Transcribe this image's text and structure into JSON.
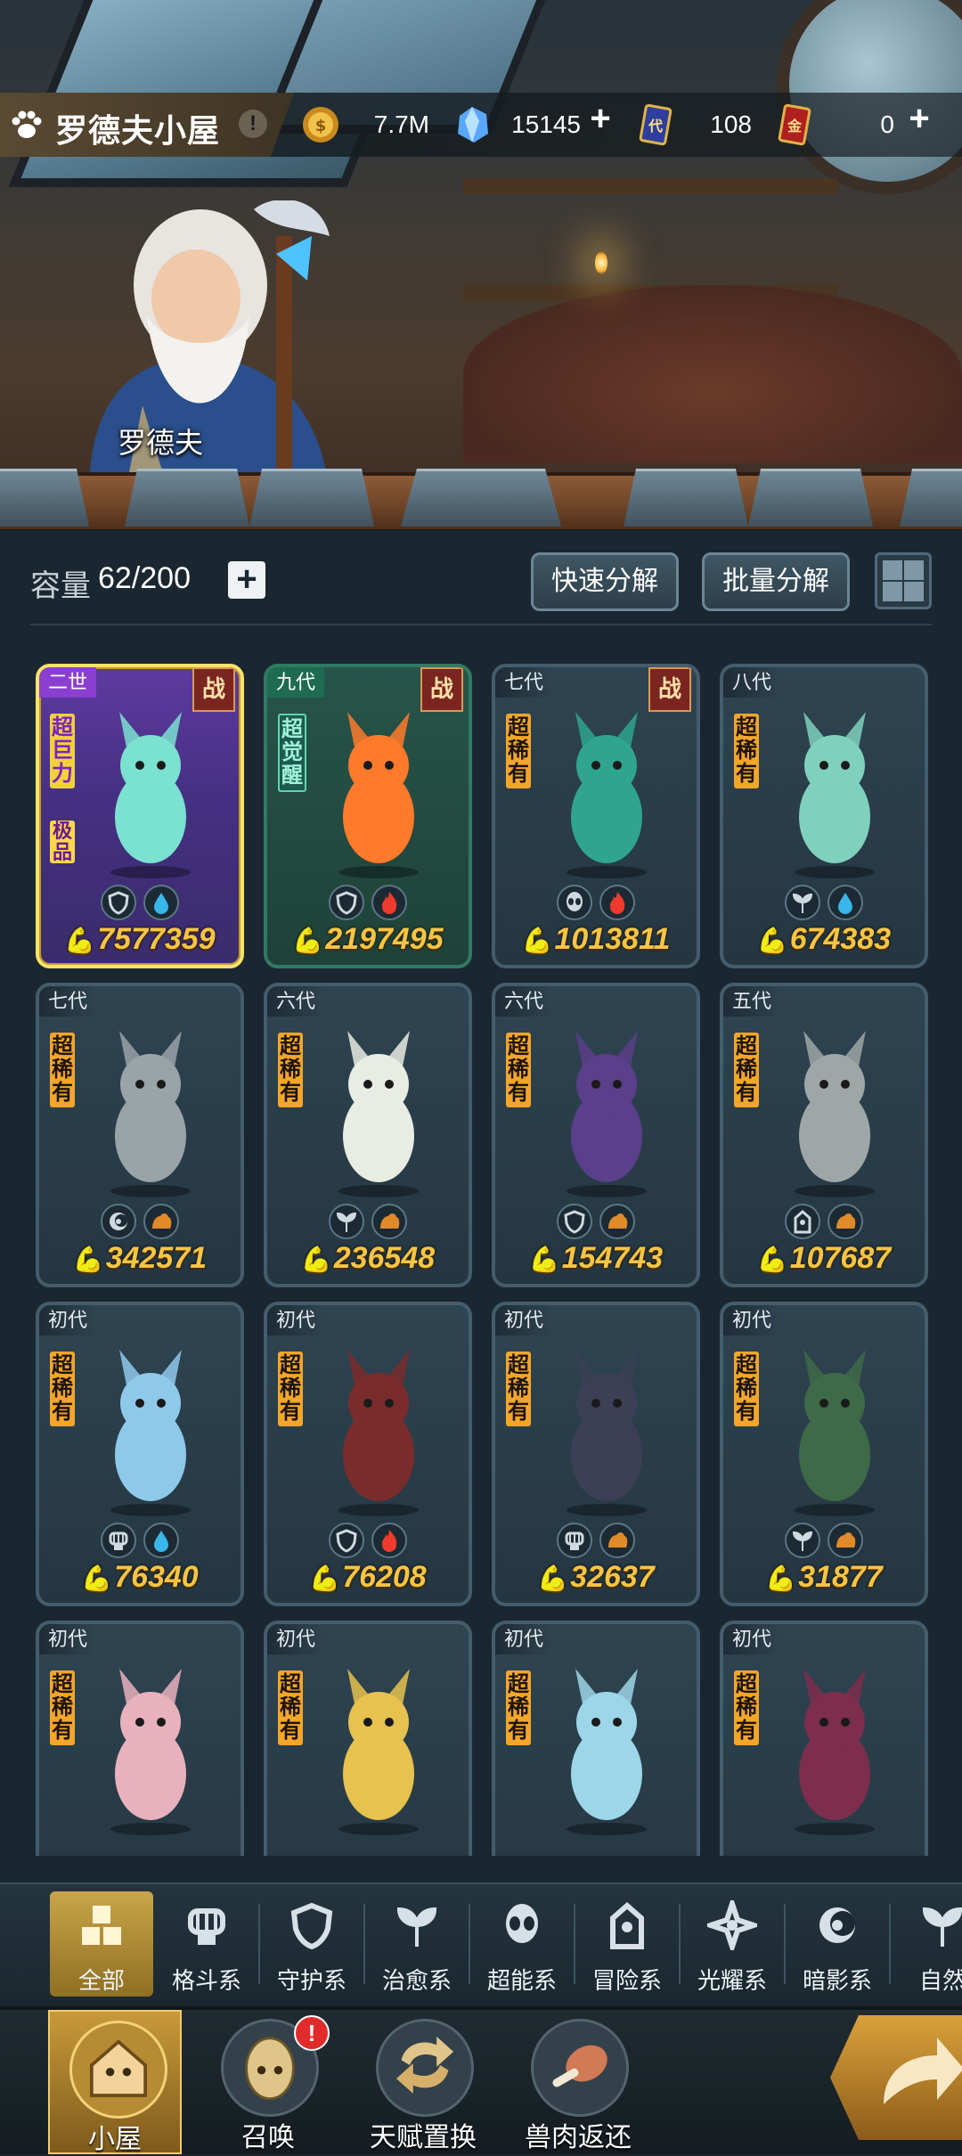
{
  "header": {
    "title": "罗德夫小屋",
    "info_icon": "!",
    "npc_name": "罗德夫"
  },
  "resources": [
    {
      "icon": "gold-coin-icon",
      "value": "7.7M",
      "has_plus": false
    },
    {
      "icon": "crystal-icon",
      "value": "15145",
      "has_plus": true
    },
    {
      "icon": "card-ticket-icon",
      "value": "108",
      "has_plus": false
    },
    {
      "icon": "gold-ticket-icon",
      "value": "0",
      "has_plus": true
    }
  ],
  "toolbar": {
    "capacity_label": "容量",
    "capacity_value": "62/200",
    "plus": "+",
    "quick_decompose": "快速分解",
    "batch_decompose": "批量分解"
  },
  "cards": [
    {
      "gen": "二世",
      "rarity": "超巨力",
      "quality": "极品",
      "war": "战",
      "style": "gold",
      "elements": [
        "guard-icon",
        "water-icon"
      ],
      "power": "7577359",
      "color": "#7be1d0"
    },
    {
      "gen": "九代",
      "rarity": "超觉醒",
      "war": "战",
      "style": "green",
      "elements": [
        "guard-icon",
        "fire-icon"
      ],
      "power": "2197495",
      "color": "#ff7a2a"
    },
    {
      "gen": "七代",
      "rarity": "超稀有",
      "war": "战",
      "elements": [
        "psychic-icon",
        "fire-icon"
      ],
      "power": "1013811",
      "color": "#2fa58f"
    },
    {
      "gen": "八代",
      "rarity": "超稀有",
      "elements": [
        "leaf-icon",
        "water-icon"
      ],
      "power": "674383",
      "color": "#7fd1bd"
    },
    {
      "gen": "七代",
      "rarity": "超稀有",
      "elements": [
        "shadow-icon",
        "earth-icon"
      ],
      "power": "342571",
      "color": "#9aa3a8"
    },
    {
      "gen": "六代",
      "rarity": "超稀有",
      "elements": [
        "leaf-icon",
        "earth-icon"
      ],
      "power": "236548",
      "color": "#e9ece2"
    },
    {
      "gen": "六代",
      "rarity": "超稀有",
      "elements": [
        "guard-icon",
        "earth-icon"
      ],
      "power": "154743",
      "color": "#5a3f8a"
    },
    {
      "gen": "五代",
      "rarity": "超稀有",
      "elements": [
        "adventure-icon",
        "earth-icon"
      ],
      "power": "107687",
      "color": "#9fa7a6"
    },
    {
      "gen": "初代",
      "rarity": "超稀有",
      "elements": [
        "fist-icon",
        "water-icon"
      ],
      "power": "76340",
      "color": "#8fc9ea"
    },
    {
      "gen": "初代",
      "rarity": "超稀有",
      "elements": [
        "guard-icon",
        "fire-icon"
      ],
      "power": "76208",
      "color": "#7a2c2c"
    },
    {
      "gen": "初代",
      "rarity": "超稀有",
      "elements": [
        "fist-icon",
        "earth-icon"
      ],
      "power": "32637",
      "color": "#3c3f55"
    },
    {
      "gen": "初代",
      "rarity": "超稀有",
      "elements": [
        "leaf-icon",
        "earth-icon"
      ],
      "power": "31877",
      "color": "#3f6a48"
    },
    {
      "gen": "初代",
      "rarity": "超稀有",
      "elements": [],
      "power": "",
      "color": "#e8b1bd"
    },
    {
      "gen": "初代",
      "rarity": "超稀有",
      "elements": [],
      "power": "",
      "color": "#e7c24e"
    },
    {
      "gen": "初代",
      "rarity": "超稀有",
      "elements": [],
      "power": "",
      "color": "#9cd6e8"
    },
    {
      "gen": "初代",
      "rarity": "超稀有",
      "elements": [],
      "power": "",
      "color": "#7c2e4c"
    }
  ],
  "categories": [
    {
      "label": "全部",
      "icon": "all-grid-icon",
      "active": true
    },
    {
      "label": "格斗系",
      "icon": "fist-icon"
    },
    {
      "label": "守护系",
      "icon": "shield-icon"
    },
    {
      "label": "治愈系",
      "icon": "sprout-icon"
    },
    {
      "label": "超能系",
      "icon": "alien-icon"
    },
    {
      "label": "冒险系",
      "icon": "tower-icon"
    },
    {
      "label": "光耀系",
      "icon": "star-icon"
    },
    {
      "label": "暗影系",
      "icon": "eclipse-icon"
    },
    {
      "label": "自然",
      "icon": "leaf-icon"
    }
  ],
  "nav": [
    {
      "label": "小屋",
      "icon": "house-icon",
      "active": true,
      "badge": ""
    },
    {
      "label": "召唤",
      "icon": "egg-icon",
      "active": false,
      "badge": "!"
    },
    {
      "label": "天赋置换",
      "icon": "swap-icon",
      "active": false,
      "badge": ""
    },
    {
      "label": "兽肉返还",
      "icon": "meat-icon",
      "active": false,
      "badge": ""
    }
  ],
  "colors": {
    "accent_gold": "#f7c544",
    "panel": "#243641",
    "active_tab": "#c9a54a"
  }
}
